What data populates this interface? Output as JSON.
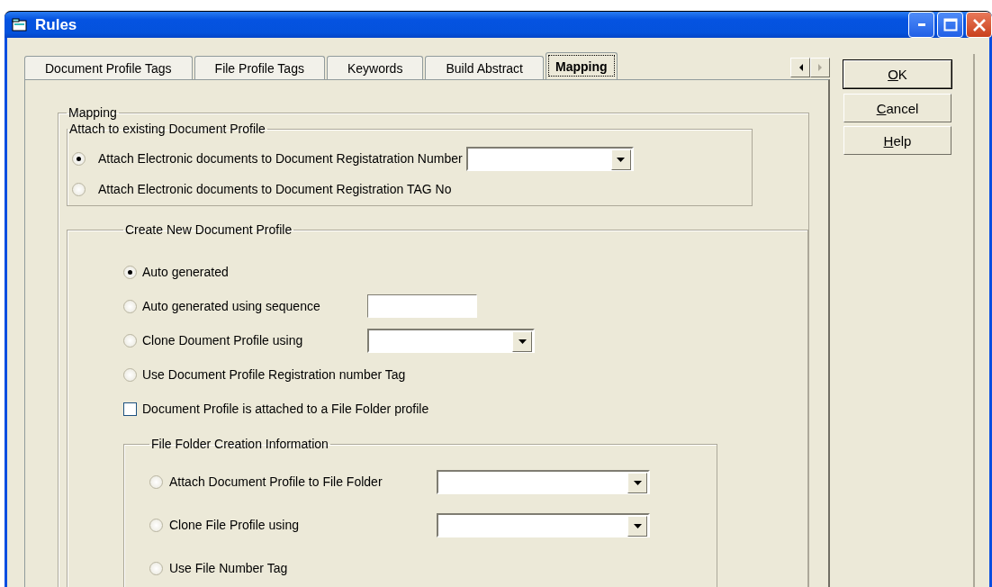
{
  "window": {
    "title": "Rules"
  },
  "tabs": [
    {
      "label": "Document Profile Tags",
      "selected": false
    },
    {
      "label": "File Profile Tags",
      "selected": false
    },
    {
      "label": "Keywords",
      "selected": false
    },
    {
      "label": "Build Abstract",
      "selected": false
    },
    {
      "label": "Mapping",
      "selected": true
    }
  ],
  "buttons": [
    {
      "label": "OK",
      "default": true
    },
    {
      "label": "Cancel",
      "default": false
    },
    {
      "label": "Help",
      "default": false
    }
  ],
  "mapping": {
    "label": "Mapping",
    "attach_group": {
      "label": "Attach to existing Document Profile",
      "options": [
        {
          "kind": "radio",
          "label": "Attach Electronic documents to Document Registatration Number",
          "selected": true,
          "field": {
            "kind": "combo"
          }
        },
        {
          "kind": "radio",
          "label": "Attach Electronic documents to Document Registration TAG No",
          "selected": false
        }
      ]
    },
    "create_group": {
      "label": "Create New Document Profile",
      "options": [
        {
          "kind": "radio",
          "label": "Auto generated",
          "selected": true
        },
        {
          "kind": "radio",
          "label": "Auto generated using sequence",
          "selected": false,
          "field": {
            "kind": "text"
          }
        },
        {
          "kind": "radio",
          "label": "Clone Doument Profile using",
          "selected": false,
          "field": {
            "kind": "combo"
          }
        },
        {
          "kind": "radio",
          "label": "Use Document Profile Registration number Tag",
          "selected": false
        },
        {
          "kind": "checkbox",
          "label": "Document Profile is attached to a File Folder profile",
          "checked": false
        }
      ],
      "file_folder_group": {
        "label": "File Folder Creation Information",
        "options": [
          {
            "kind": "radio",
            "label": "Attach Document Profile to File Folder",
            "selected": false,
            "field": {
              "kind": "combo"
            }
          },
          {
            "kind": "radio",
            "label": "Clone File Profile using",
            "selected": false,
            "field": {
              "kind": "combo"
            }
          },
          {
            "kind": "radio",
            "label": "Use File Number Tag",
            "selected": false
          }
        ]
      }
    }
  }
}
